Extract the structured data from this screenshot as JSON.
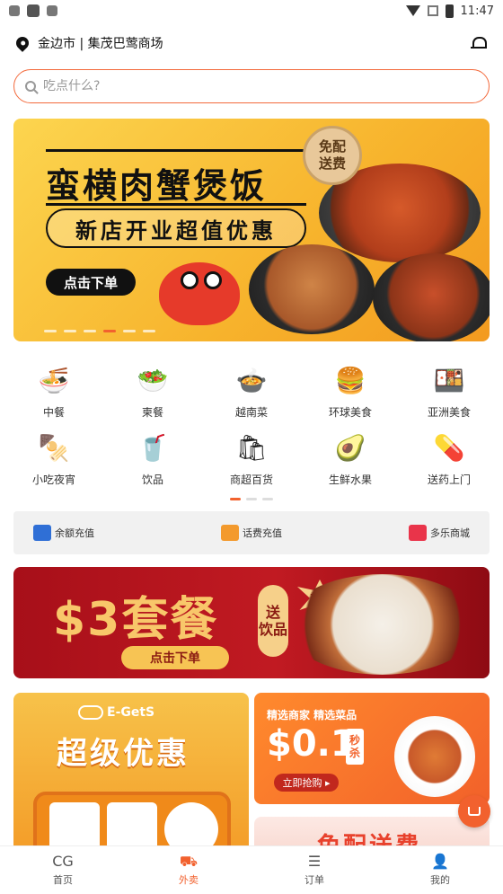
{
  "status_bar": {
    "time": "11:47"
  },
  "location": {
    "text": "金边市 | 集茂巴莺商场"
  },
  "search": {
    "placeholder": "吃点什么?"
  },
  "banner": {
    "title": "蛮横肉蟹煲饭",
    "subtitle": "新店开业超值优惠",
    "button": "点击下单",
    "badge_line1": "免配",
    "badge_line2": "送费",
    "active_dot_index": 3
  },
  "categories": [
    {
      "label": "中餐",
      "icon": "bowl-icon",
      "glyph": "🍜"
    },
    {
      "label": "柬餐",
      "icon": "salad-bowl-icon",
      "glyph": "🥗"
    },
    {
      "label": "越南菜",
      "icon": "pho-bowl-icon",
      "glyph": "🍲"
    },
    {
      "label": "环球美食",
      "icon": "burger-icon",
      "glyph": "🍔"
    },
    {
      "label": "亚洲美食",
      "icon": "cloche-icon",
      "glyph": "🍱"
    },
    {
      "label": "小吃夜宵",
      "icon": "skewer-icon",
      "glyph": "🍢"
    },
    {
      "label": "饮品",
      "icon": "drink-icon",
      "glyph": "🥤"
    },
    {
      "label": "商超百货",
      "icon": "mall-icon",
      "glyph": "🛍"
    },
    {
      "label": "生鲜水果",
      "icon": "avocado-icon",
      "glyph": "🥑"
    },
    {
      "label": "送药上门",
      "icon": "medicine-kit-icon",
      "glyph": "💊"
    }
  ],
  "recharge": [
    {
      "label": "余额充值",
      "icon": "wallet-icon"
    },
    {
      "label": "话费充值",
      "icon": "phone-topup-icon"
    },
    {
      "label": "多乐商城",
      "icon": "shop-icon"
    }
  ],
  "promo": {
    "title": "$3套餐",
    "gift_line1": "送",
    "gift_line2": "饮品",
    "flash": "美味",
    "button": "点击下单"
  },
  "card_left": {
    "brand": "E-GetS",
    "title": "超级优惠"
  },
  "card_right": {
    "subtitle": "精选商家 精选菜品",
    "price": "$0.1",
    "tag_line1": "秒",
    "tag_line2": "杀",
    "button": "立即抢购 ▸"
  },
  "card_right2": {
    "title": "免配送费"
  },
  "bottom_nav": [
    {
      "label": "首页",
      "icon": "home-logo-icon",
      "glyph": "CG"
    },
    {
      "label": "外卖",
      "icon": "delivery-icon",
      "glyph": "⛟"
    },
    {
      "label": "订单",
      "icon": "order-list-icon",
      "glyph": "☰"
    },
    {
      "label": "我的",
      "icon": "profile-icon",
      "glyph": "👤"
    }
  ],
  "colors": {
    "accent": "#f2612e",
    "promo_red": "#b3141c",
    "banner_yellow": "#f7b32c"
  }
}
